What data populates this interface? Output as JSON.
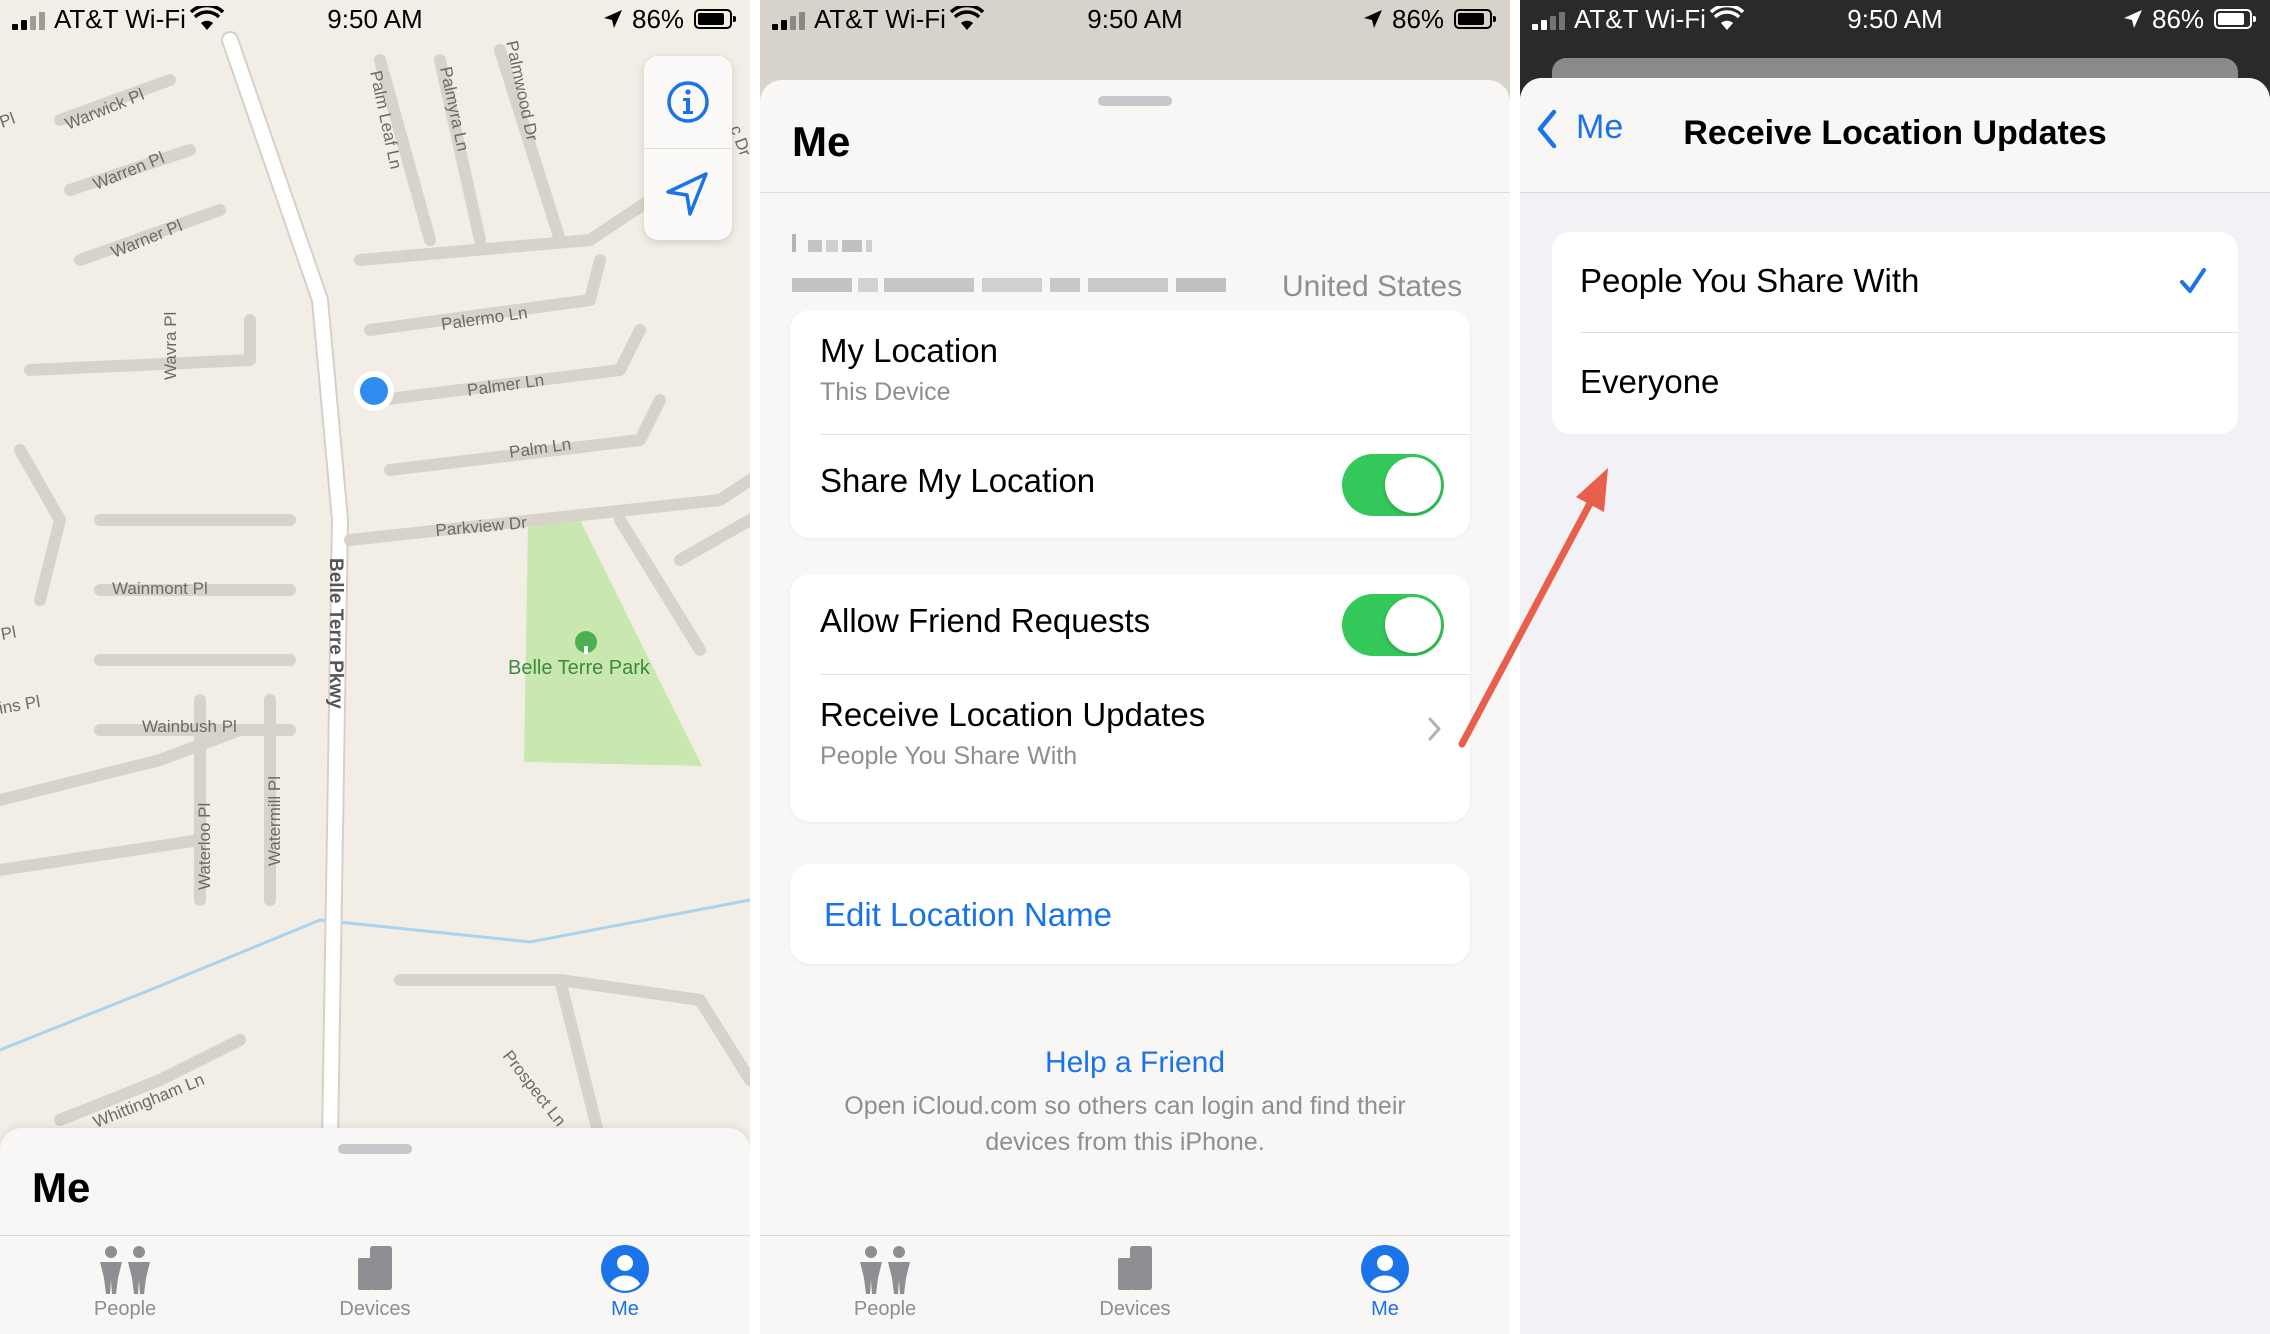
{
  "status_bar": {
    "carrier": "AT&T Wi-Fi",
    "time": "9:50 AM",
    "battery": "86%"
  },
  "tabs": [
    {
      "label": "People",
      "icon": "people-icon"
    },
    {
      "label": "Devices",
      "icon": "devices-icon"
    },
    {
      "label": "Me",
      "icon": "me-icon"
    }
  ],
  "active_tab": "Me",
  "colors": {
    "accent": "#1a73e8",
    "toggle_on": "#34c759",
    "park": "#c9e8b0",
    "water": "#a8d4f0",
    "annotation_arrow": "#e8604c"
  },
  "screen1": {
    "map": {
      "streets": [
        "Warwick Pl",
        "Warren Pl",
        "Warner Pl",
        "Palm Leaf Ln",
        "Palmyra Ln",
        "Palmwood Dr",
        "Palermo Ln",
        "Palmer Ln",
        "Palm Ln",
        "Parkview Dr",
        "Wavra Pl",
        "Wainmont Pl",
        "Wainbush Pl",
        "Waterloo Pl",
        "Watermill Pl",
        "Belle Terre Pkwy",
        "Whittingham Ln",
        "Prospect Ln",
        "Pl",
        "Pl",
        "ins Pl",
        "Pl",
        "c Dr"
      ],
      "park_name": "Belle Terre Park"
    },
    "map_buttons": [
      "info-icon",
      "location-arrow-icon"
    ],
    "sheet_title": "Me"
  },
  "screen2": {
    "title": "Me",
    "address_country": "United States",
    "my_location": {
      "label": "My Location",
      "value": "This Device"
    },
    "share_my_location": {
      "label": "Share My Location",
      "enabled": true
    },
    "allow_friend_requests": {
      "label": "Allow Friend Requests",
      "enabled": true
    },
    "receive_updates": {
      "label": "Receive Location Updates",
      "value": "People You Share With"
    },
    "edit_location_name": "Edit Location Name",
    "help_title": "Help a Friend",
    "help_text_line1": "Open iCloud.com so others can login and find their",
    "help_text_line2": "devices from this iPhone."
  },
  "screen3": {
    "back_label": "Me",
    "title": "Receive Location Updates",
    "options": [
      {
        "label": "People You Share With",
        "selected": true
      },
      {
        "label": "Everyone",
        "selected": false
      }
    ]
  }
}
